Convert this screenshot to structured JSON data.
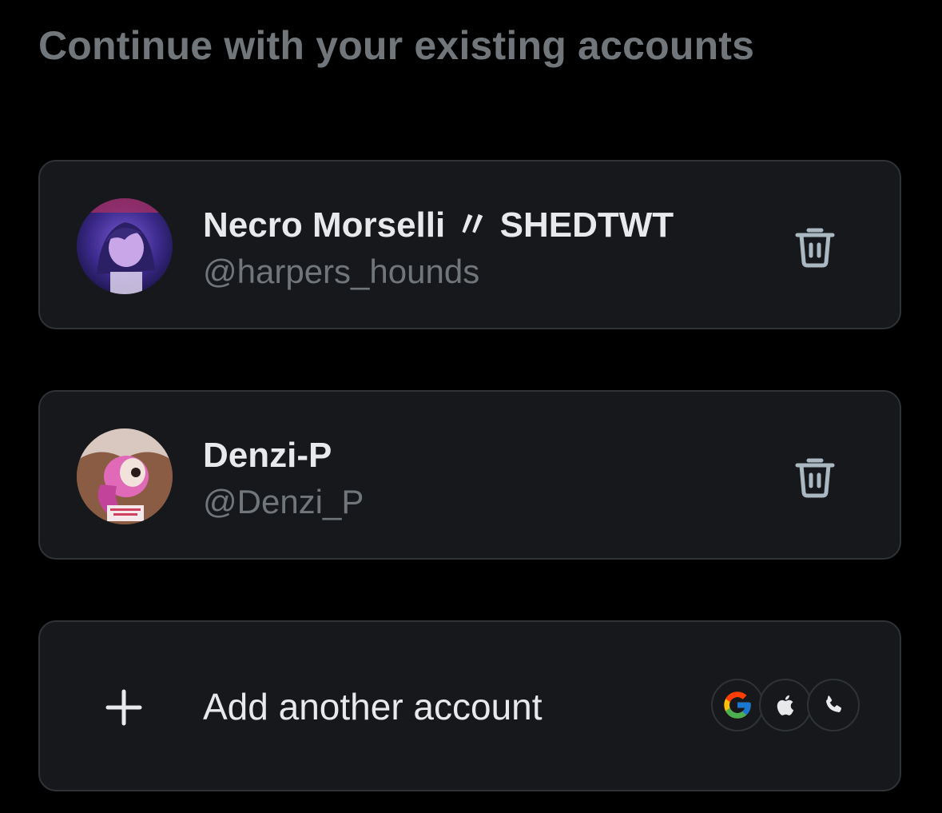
{
  "heading": "Continue with your existing accounts",
  "accounts": [
    {
      "display_name": "Necro Morselli 〃 SHEDTWT",
      "handle": "@harpers_hounds",
      "avatar_icon": "avatar-purple-anime"
    },
    {
      "display_name": "Denzi-P",
      "handle": "@Denzi_P",
      "avatar_icon": "avatar-pink-anime"
    }
  ],
  "add_account": {
    "label": "Add another account",
    "icon": "plus-icon",
    "providers": [
      "google-icon",
      "apple-icon",
      "phone-icon"
    ]
  },
  "colors": {
    "background": "#000000",
    "card": "#16181c",
    "border": "#2f3336",
    "primary_text": "#e7e9ea",
    "secondary_text": "#71767b"
  }
}
